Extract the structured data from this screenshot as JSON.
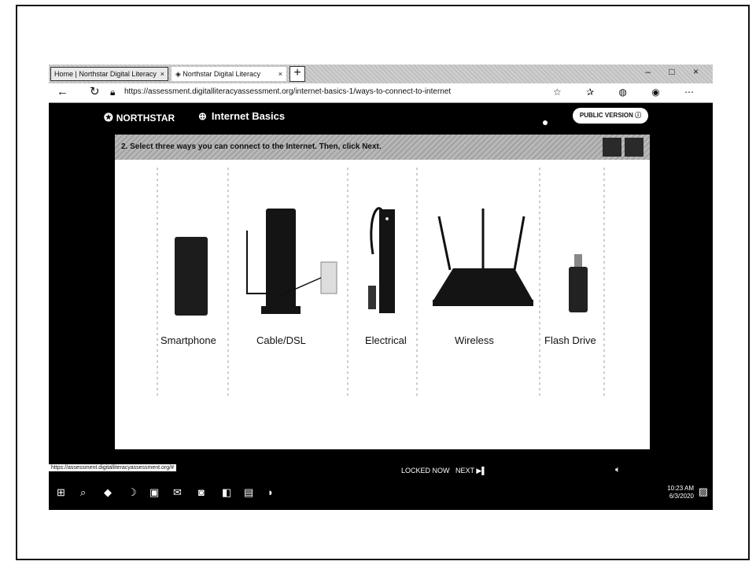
{
  "browser": {
    "tabs": [
      {
        "label": "Home | Northstar Digital Literacy",
        "close": "×"
      },
      {
        "label": "Northstar Digital Literacy",
        "close": "×"
      }
    ],
    "new_tab": "+",
    "window_controls": "– □ ×",
    "url": "https://assessment.digitalliteracyassessment.org/internet-basics-1/ways-to-connect-to-internet"
  },
  "page": {
    "brand": "NORTHSTAR",
    "course": "Internet Basics",
    "public_version": "PUBLIC VERSION",
    "question": "2. Select three ways you can connect to the Internet. Then, click Next.",
    "options": [
      {
        "label": "Smartphone"
      },
      {
        "label": "Cable/DSL"
      },
      {
        "label": "Electrical"
      },
      {
        "label": "Wireless"
      },
      {
        "label": "Flash Drive"
      }
    ],
    "next_label": "NEXT",
    "next_prefix": "LOCKED NOW"
  },
  "status": {
    "url": "https://assessment.digitalliteracyassessment.org/#"
  },
  "taskbar": {
    "time": "10:23 AM",
    "date": "6/3/2020"
  }
}
